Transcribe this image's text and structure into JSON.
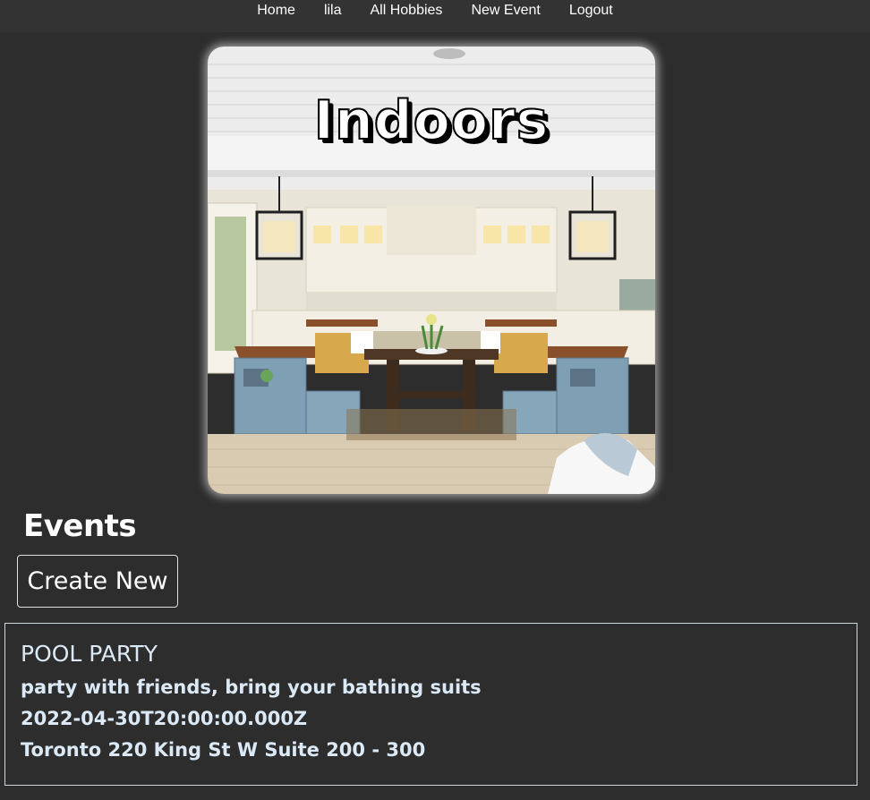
{
  "nav": {
    "items": [
      {
        "label": "Home"
      },
      {
        "label": "lila"
      },
      {
        "label": "All Hobbies"
      },
      {
        "label": "New Event"
      },
      {
        "label": "Logout"
      }
    ]
  },
  "hero": {
    "title": "Indoors"
  },
  "events": {
    "heading": "Events",
    "create_label": "Create New",
    "items": [
      {
        "name": "POOL PARTY",
        "description": "party with friends, bring your bathing suits",
        "date": "2022-04-30T20:00:00.000Z",
        "location": "Toronto 220 King St W Suite 200 - 300"
      }
    ]
  },
  "colors": {
    "background": "#2d2d2d",
    "navbar": "#333333",
    "card_text": "#dbe9f6"
  }
}
